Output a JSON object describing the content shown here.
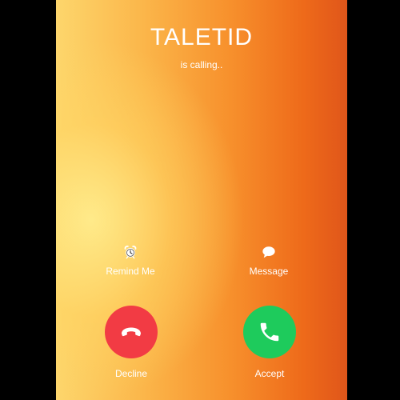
{
  "caller": {
    "name": "TALETID",
    "status": "is calling.."
  },
  "secondary_actions": {
    "remind_label": "Remind Me",
    "remind_icon": "alarm-clock-icon",
    "message_label": "Message",
    "message_icon": "speech-bubble-icon"
  },
  "call_actions": {
    "decline_label": "Decline",
    "decline_icon": "phone-hangup-icon",
    "decline_color": "#f23b44",
    "accept_label": "Accept",
    "accept_icon": "phone-icon",
    "accept_color": "#1ecb5c"
  }
}
